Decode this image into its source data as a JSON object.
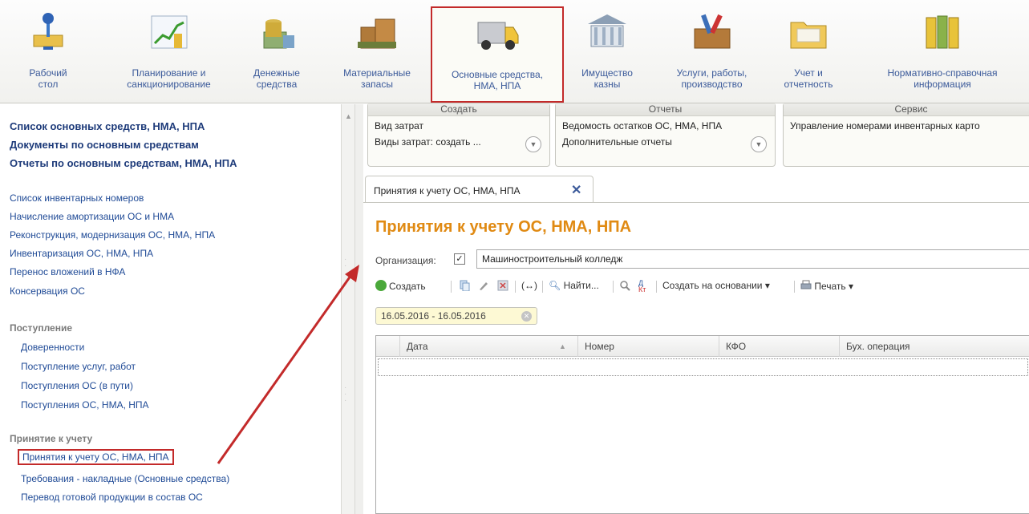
{
  "sections": [
    {
      "id": "desktop",
      "label": "Рабочий\nстол",
      "icon": "desk-lamp-icon"
    },
    {
      "id": "planning",
      "label": "Планирование и\nсанкционирование",
      "icon": "chart-icon"
    },
    {
      "id": "money",
      "label": "Денежные\nсредства",
      "icon": "coins-icon"
    },
    {
      "id": "materials",
      "label": "Материальные\nзапасы",
      "icon": "boxes-icon"
    },
    {
      "id": "fixed_assets",
      "label": "Основные средства,\nНМА, НПА",
      "icon": "truck-icon"
    },
    {
      "id": "treasury",
      "label": "Имущество\nказны",
      "icon": "building-icon"
    },
    {
      "id": "services",
      "label": "Услуги, работы,\nпроизводство",
      "icon": "toolbox-icon"
    },
    {
      "id": "reporting",
      "label": "Учет и\nотчетность",
      "icon": "folder-icon"
    },
    {
      "id": "reference",
      "label": "Нормативно-справочная\nинформация",
      "icon": "binders-icon"
    }
  ],
  "leftnav": {
    "bold_links": [
      "Список основных средств, НМА, НПА",
      "Документы по основным средствам",
      "Отчеты по основным средствам, НМА, НПА"
    ],
    "links": [
      "Список инвентарных номеров",
      "Начисление амортизации ОС и НМА",
      "Реконструкция, модернизация ОС, НМА, НПА",
      "Инвентаризация ОС, НМА, НПА",
      "Перенос вложений в НФА",
      "Консервация ОС"
    ],
    "group_receipt": "Поступление",
    "receipt_items": [
      "Доверенности",
      "Поступление услуг, работ",
      "Поступления ОС (в пути)",
      "Поступления ОС, НМА, НПА"
    ],
    "group_accept": "Принятие к учету",
    "accept_items": [
      "Принятия к учету ОС, НМА, НПА",
      "Требования - накладные (Основные средства)",
      "Перевод готовой продукции в состав ОС"
    ]
  },
  "panels": {
    "create": {
      "title": "Создать",
      "items": [
        "Вид затрат",
        "Виды затрат: создать ..."
      ]
    },
    "reports": {
      "title": "Отчеты",
      "items": [
        "Ведомость остатков ОС, НМА, НПА",
        "Дополнительные отчеты"
      ]
    },
    "service": {
      "title": "Сервис",
      "items": [
        "Управление номерами инвентарных карто"
      ]
    }
  },
  "tab": {
    "label": "Принятия к учету ОС, НМА, НПА",
    "close": "✕"
  },
  "form": {
    "title": "Принятия к учету ОС, НМА, НПА",
    "org_label": "Организация:",
    "org_checked": "✓",
    "org_value": "Машиностроительный колледж",
    "period": "16.05.2016 - 16.05.2016"
  },
  "toolbar": {
    "create": "Создать",
    "find": "Найти...",
    "create_based": "Создать на основании",
    "print": "Печать",
    "ab_top": "Д",
    "ab_bottom": "Кт",
    "link_glyph": "(↔)",
    "dropdown_glyph": "▾"
  },
  "table": {
    "columns": [
      "Дата",
      "Номер",
      "КФО",
      "Бух. операция"
    ],
    "sort_glyph": "▲"
  },
  "colors": {
    "accent": "#e08a13",
    "highlight": "#c32a2a",
    "link": "#1f4a96"
  }
}
